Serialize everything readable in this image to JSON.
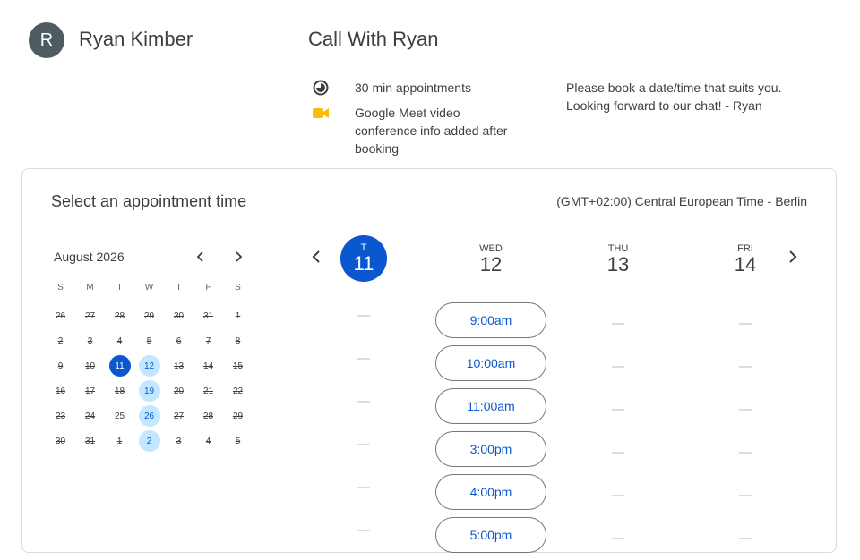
{
  "host": {
    "initial": "R",
    "name": "Ryan Kimber"
  },
  "event": {
    "title": "Call With Ryan",
    "duration_text": "30 min appointments",
    "conference_text": "Google Meet video conference info added after booking",
    "description": "Please book a date/time that suits you. Looking forward to our chat! - Ryan"
  },
  "booking": {
    "title": "Select an appointment time",
    "timezone": "(GMT+02:00) Central European Time - Berlin"
  },
  "mini_calendar": {
    "month_label": "August 2026",
    "dow": [
      "S",
      "M",
      "T",
      "W",
      "T",
      "F",
      "S"
    ],
    "weeks": [
      [
        {
          "d": "26",
          "s": "unavail"
        },
        {
          "d": "27",
          "s": "unavail"
        },
        {
          "d": "28",
          "s": "unavail"
        },
        {
          "d": "29",
          "s": "unavail"
        },
        {
          "d": "30",
          "s": "unavail"
        },
        {
          "d": "31",
          "s": "unavail"
        },
        {
          "d": "1",
          "s": "unavail"
        }
      ],
      [
        {
          "d": "2",
          "s": "unavail"
        },
        {
          "d": "3",
          "s": "unavail"
        },
        {
          "d": "4",
          "s": "unavail"
        },
        {
          "d": "5",
          "s": "unavail"
        },
        {
          "d": "6",
          "s": "unavail"
        },
        {
          "d": "7",
          "s": "unavail"
        },
        {
          "d": "8",
          "s": "unavail"
        }
      ],
      [
        {
          "d": "9",
          "s": "unavail"
        },
        {
          "d": "10",
          "s": "unavail"
        },
        {
          "d": "11",
          "s": "today"
        },
        {
          "d": "12",
          "s": "avail"
        },
        {
          "d": "13",
          "s": "unavail"
        },
        {
          "d": "14",
          "s": "unavail"
        },
        {
          "d": "15",
          "s": "unavail"
        }
      ],
      [
        {
          "d": "16",
          "s": "unavail"
        },
        {
          "d": "17",
          "s": "unavail"
        },
        {
          "d": "18",
          "s": "unavail"
        },
        {
          "d": "19",
          "s": "avail"
        },
        {
          "d": "20",
          "s": "unavail"
        },
        {
          "d": "21",
          "s": "unavail"
        },
        {
          "d": "22",
          "s": "unavail"
        }
      ],
      [
        {
          "d": "23",
          "s": "unavail"
        },
        {
          "d": "24",
          "s": "unavail"
        },
        {
          "d": "25",
          "s": "plain"
        },
        {
          "d": "26",
          "s": "avail"
        },
        {
          "d": "27",
          "s": "unavail"
        },
        {
          "d": "28",
          "s": "unavail"
        },
        {
          "d": "29",
          "s": "unavail"
        }
      ],
      [
        {
          "d": "30",
          "s": "unavail"
        },
        {
          "d": "31",
          "s": "unavail"
        },
        {
          "d": "1",
          "s": "unavail"
        },
        {
          "d": "2",
          "s": "avail"
        },
        {
          "d": "3",
          "s": "unavail"
        },
        {
          "d": "4",
          "s": "unavail"
        },
        {
          "d": "5",
          "s": "unavail"
        }
      ]
    ]
  },
  "week": {
    "days": [
      {
        "dow": "T",
        "num": "11",
        "today": true,
        "slots": [
          "",
          "",
          "",
          "",
          "",
          ""
        ]
      },
      {
        "dow": "WED",
        "num": "12",
        "today": false,
        "slots": [
          "9:00am",
          "10:00am",
          "11:00am",
          "3:00pm",
          "4:00pm",
          "5:00pm"
        ]
      },
      {
        "dow": "THU",
        "num": "13",
        "today": false,
        "slots": [
          "",
          "",
          "",
          "",
          "",
          ""
        ]
      },
      {
        "dow": "FRI",
        "num": "14",
        "today": false,
        "slots": [
          "",
          "",
          "",
          "",
          "",
          ""
        ]
      }
    ]
  },
  "colors": {
    "accent": "#0b57d0",
    "available": "#c2e7ff",
    "avatar": "#4f5b62",
    "meet_yellow": "#fbbc04"
  },
  "icons": {
    "duration": "clock-half-icon",
    "conference": "video-camera-icon",
    "prev": "chevron-left-icon",
    "next": "chevron-right-icon"
  }
}
